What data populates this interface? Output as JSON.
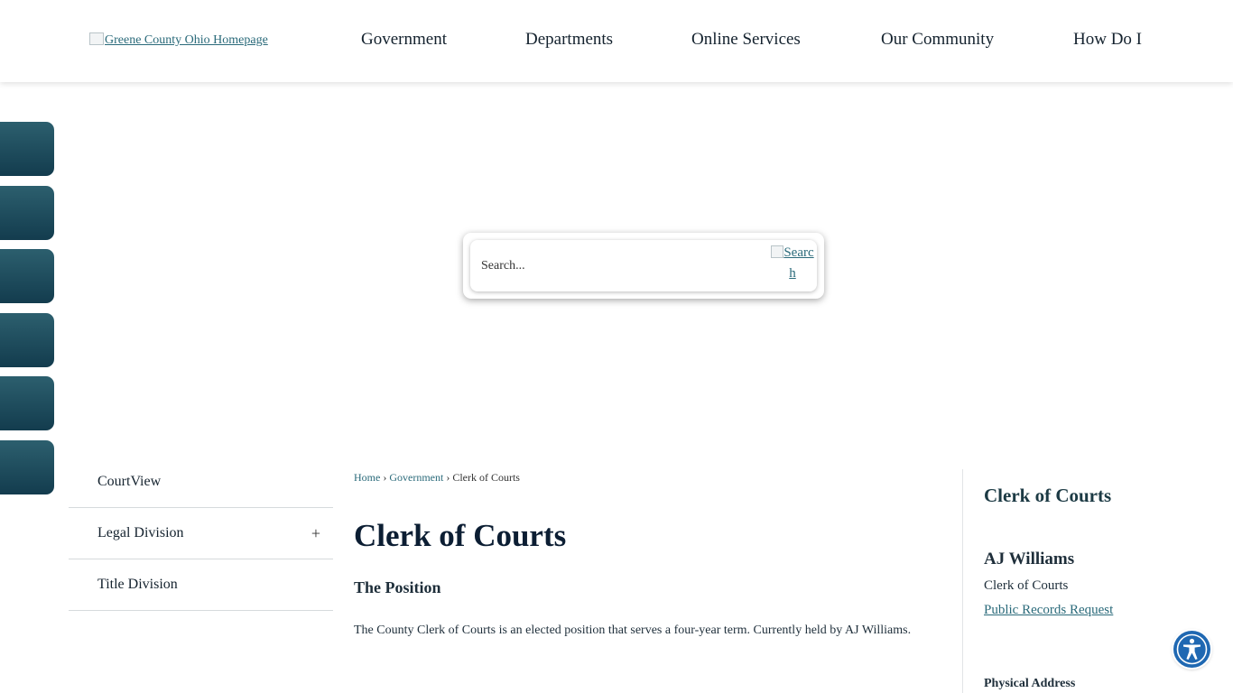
{
  "header": {
    "logo_alt": "Greene County Ohio Homepage",
    "nav": [
      {
        "label": "Government"
      },
      {
        "label": "Departments"
      },
      {
        "label": "Online Services"
      },
      {
        "label": "Our Community"
      },
      {
        "label": "How Do I"
      }
    ]
  },
  "side_tabs": [
    "tab-1",
    "tab-2",
    "tab-3",
    "tab-4",
    "tab-5",
    "tab-6"
  ],
  "search": {
    "placeholder": "Search...",
    "button_alt_line1": "Searc",
    "button_alt_line2": "h"
  },
  "subnav": {
    "items": [
      {
        "label": "CourtView"
      },
      {
        "label": "Legal Division",
        "expand": "+"
      },
      {
        "label": "Title Division"
      }
    ]
  },
  "breadcrumb": {
    "items": [
      "Home",
      "Government",
      "Clerk of Courts"
    ],
    "separator": "›"
  },
  "main": {
    "title": "Clerk of Courts",
    "section_heading": "The Position",
    "body": "The County Clerk of Courts is an elected position that serves a four-year term. Currently held by AJ Williams."
  },
  "sidebar": {
    "title": "Clerk of Courts",
    "contact_name": "AJ Williams",
    "contact_role": "Clerk of Courts",
    "contact_link": "Public Records Request",
    "address_label": "Physical Address"
  },
  "colors": {
    "accent": "#2a6a7a",
    "tab_gradient_top": "#2c5f6e",
    "tab_gradient_bottom": "#133c4e",
    "accessibility_blue": "#1f68b2"
  },
  "icons": {
    "accessibility": "accessibility-person-icon",
    "expand": "plus-icon"
  }
}
